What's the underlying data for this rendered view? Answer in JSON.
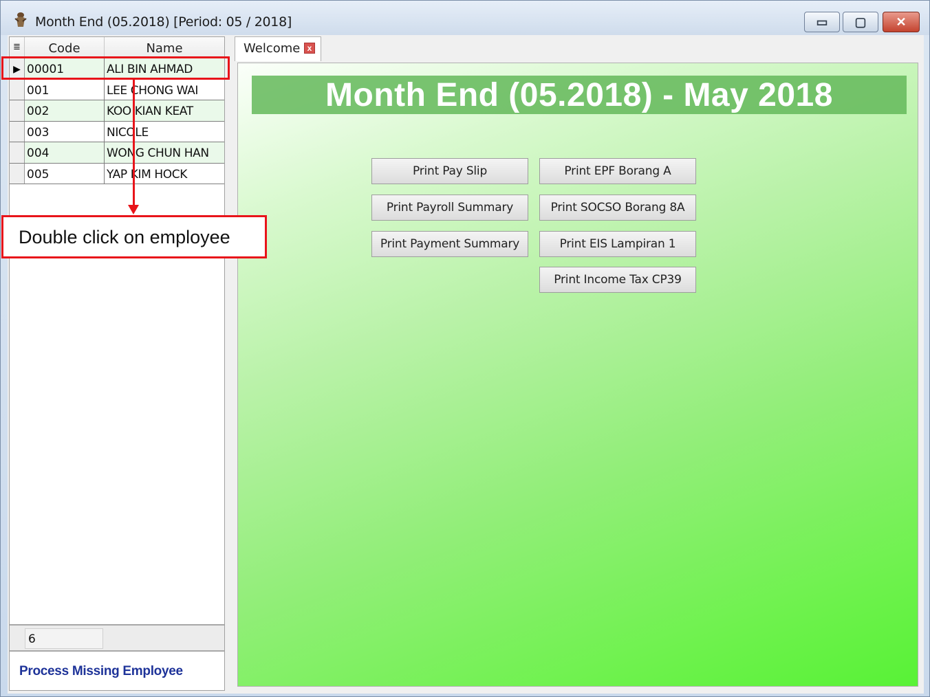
{
  "window": {
    "title": "Month End (05.2018) [Period: 05 / 2018]",
    "controls": {
      "minimize": "▭",
      "maximize": "▢",
      "close": "✕"
    }
  },
  "grid": {
    "header": {
      "indicator": "≣",
      "code": "Code",
      "name": "Name"
    },
    "rows": [
      {
        "code": "00001",
        "name": "ALI BIN AHMAD",
        "selected": true
      },
      {
        "code": "001",
        "name": "LEE CHONG WAI"
      },
      {
        "code": "002",
        "name": "KOO KIAN KEAT"
      },
      {
        "code": "003",
        "name": "NICOLE"
      },
      {
        "code": "004",
        "name": "WONG CHUN HAN"
      },
      {
        "code": "005",
        "name": "YAP KIM HOCK"
      }
    ],
    "count": "6",
    "selected_marker": "▶"
  },
  "process_link": "Process Missing Employee",
  "tabs": [
    {
      "label": "Welcome",
      "close": "x"
    }
  ],
  "welcome": {
    "banner": "Month End (05.2018) - May 2018",
    "buttons": {
      "print_pay_slip": "Print Pay Slip",
      "print_payroll_summary": "Print Payroll Summary",
      "print_payment_summary": "Print Payment Summary",
      "print_epf_borang_a": "Print EPF Borang A",
      "print_socso_borang_8a": "Print SOCSO Borang 8A",
      "print_eis_lampiran_1": "Print EIS Lampiran 1",
      "print_income_tax_cp39": "Print Income Tax CP39"
    }
  },
  "annotation": {
    "callout": "Double click on employee",
    "color": "#e8141a"
  },
  "colors": {
    "link": "#1e3399",
    "banner_bg": "#64b95a"
  }
}
